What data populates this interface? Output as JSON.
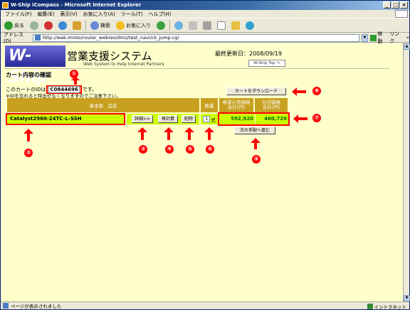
{
  "window": {
    "title": "W-Ship iCompass - Microsoft Internet Explorer"
  },
  "menu": [
    "ファイル(F)",
    "編集(E)",
    "表示(V)",
    "お気に入り(A)",
    "ツール(T)",
    "ヘルプ(H)"
  ],
  "toolbar": {
    "back": "戻る",
    "search": "検索",
    "favorites": "お気に入り"
  },
  "address": {
    "label": "アドレス(D)",
    "url": "http://wak.imoto/router_webreo/dmz/test_navi/ck_jump.cgi",
    "go": "移動",
    "links": "リンク"
  },
  "header": {
    "logo": "W-Ship",
    "title": "営業支援システム",
    "subtitle": "Web System to Help Internet Partners",
    "last_updated": "最終更新日：2008/09/19",
    "top_link": "W-Ship Top へ"
  },
  "page": {
    "title": "カート内容の確認",
    "cart_id_prefix": "このカートのIDは",
    "cart_id": "C0844696",
    "cart_id_suffix": "です。",
    "note": "※IDを忘れると呼出せなくなりますのでご注意下さい。",
    "download_button": "カートをダウンロード",
    "next_button": "次の手配へ進む"
  },
  "table": {
    "headers": {
      "product": "基本部　品名",
      "quantity": "数量",
      "list_price_line1": "希望小売価格",
      "list_price_line2": "合計(円)",
      "net_price_line1": "仕切価格",
      "net_price_line2": "合計(円)"
    },
    "row": {
      "product": "Catalyst2960-24TC-L-SSH",
      "detail_button": "詳細>>",
      "recalc_button": "再計算",
      "delete_button": "削除",
      "quantity": "1",
      "quantity_unit": "式",
      "list_price_total": "592,920",
      "net_price_total": "460,720"
    }
  },
  "annotations": [
    "①",
    "②",
    "③",
    "④",
    "⑤",
    "⑥",
    "⑦",
    "⑧",
    "⑨"
  ],
  "status": {
    "left": "ページが表示されました",
    "zone": "イントラネット"
  },
  "colors": {
    "annotation": "#ff0000",
    "row_highlight": "#ccff00",
    "header_bg": "#c8a020",
    "page_bg": "#ffffcc"
  }
}
